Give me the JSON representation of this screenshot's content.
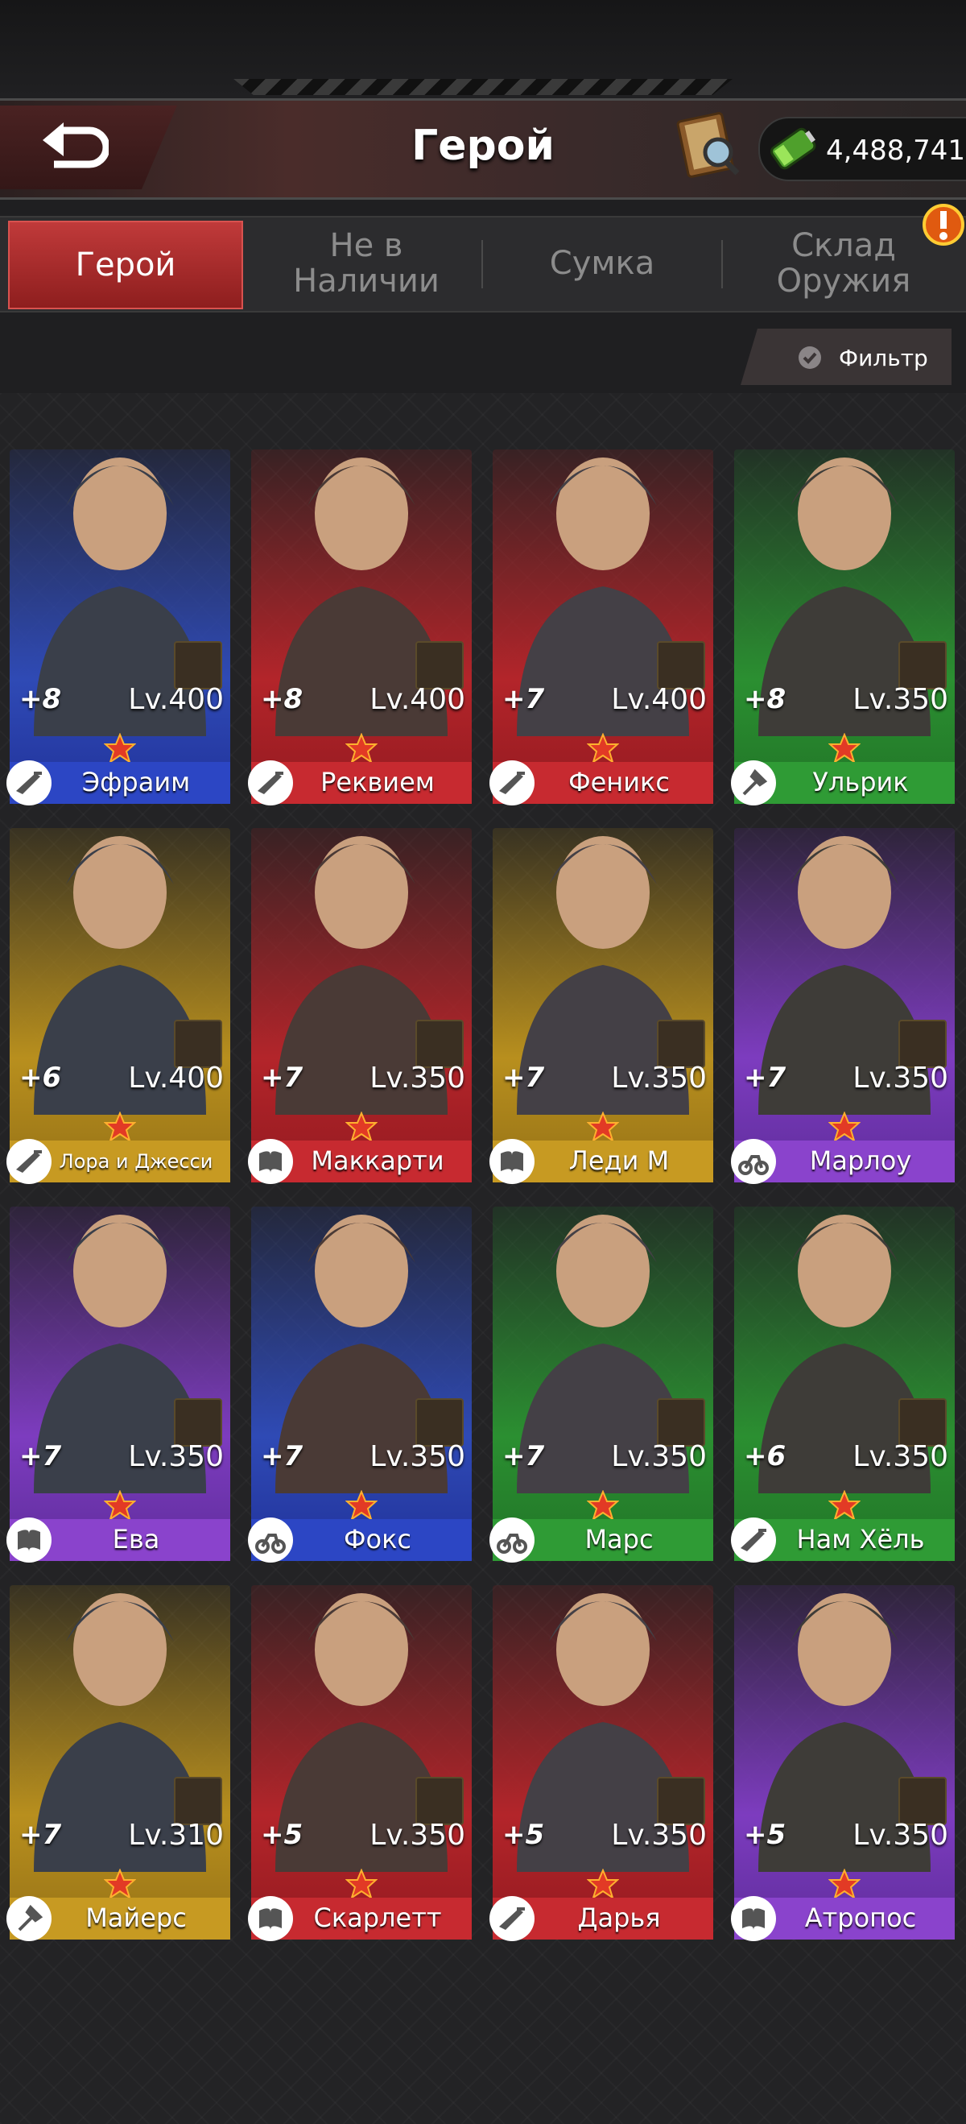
{
  "header": {
    "title": "Герой",
    "currency_amount": "4,488,741",
    "back_icon": "back-arrow-icon",
    "guide_icon": "book-magnifier-icon",
    "currency_icon": "battery-icon"
  },
  "tabs": [
    {
      "label": "Герой",
      "active": true
    },
    {
      "label": "Не в Наличии",
      "active": false
    },
    {
      "label": "Сумка",
      "active": false
    },
    {
      "label": "Склад Оружия",
      "active": false
    }
  ],
  "filter_label": "Фильтр",
  "heroes": [
    {
      "name": "Эфраим",
      "level": "Lv.400",
      "plus": "+8",
      "rarity": "blue",
      "stars": 1
    },
    {
      "name": "Реквием",
      "level": "Lv.400",
      "plus": "+8",
      "rarity": "red",
      "stars": 1
    },
    {
      "name": "Феникс",
      "level": "Lv.400",
      "plus": "+7",
      "rarity": "red",
      "stars": 1
    },
    {
      "name": "Ульрик",
      "level": "Lv.350",
      "plus": "+8",
      "rarity": "green",
      "stars": 1
    },
    {
      "name": "Лора и Джесси",
      "level": "Lv.400",
      "plus": "+6",
      "rarity": "gold",
      "stars": 1
    },
    {
      "name": "Маккарти",
      "level": "Lv.350",
      "plus": "+7",
      "rarity": "red",
      "stars": 1
    },
    {
      "name": "Леди М",
      "level": "Lv.350",
      "plus": "+7",
      "rarity": "gold",
      "stars": 1
    },
    {
      "name": "Марлоу",
      "level": "Lv.350",
      "plus": "+7",
      "rarity": "purple",
      "stars": 1
    },
    {
      "name": "Ева",
      "level": "Lv.350",
      "plus": "+7",
      "rarity": "purple",
      "stars": 1
    },
    {
      "name": "Фокс",
      "level": "Lv.350",
      "plus": "+7",
      "rarity": "blue",
      "stars": 1
    },
    {
      "name": "Марс",
      "level": "Lv.350",
      "plus": "+7",
      "rarity": "green",
      "stars": 1
    },
    {
      "name": "Нам Хёль",
      "level": "Lv.350",
      "plus": "+6",
      "rarity": "green",
      "stars": 1
    },
    {
      "name": "Майерс",
      "level": "Lv.310",
      "plus": "+7",
      "rarity": "gold",
      "stars": 1
    },
    {
      "name": "Скарлетт",
      "level": "Lv.350",
      "plus": "+5",
      "rarity": "red",
      "stars": 1
    },
    {
      "name": "Дарья",
      "level": "Lv.350",
      "plus": "+5",
      "rarity": "red",
      "stars": 1
    },
    {
      "name": "Атропос",
      "level": "Lv.350",
      "plus": "+5",
      "rarity": "purple",
      "stars": 1
    }
  ]
}
